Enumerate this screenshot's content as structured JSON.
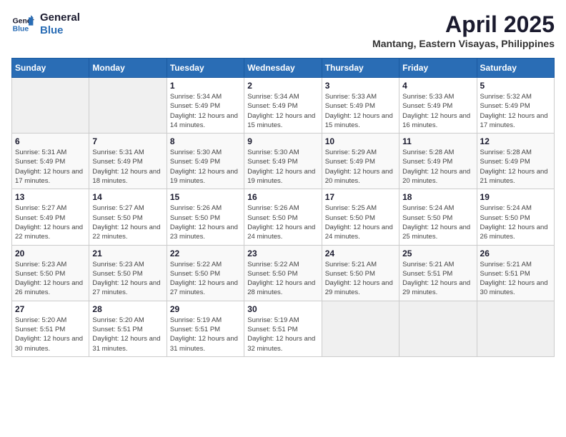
{
  "header": {
    "logo_line1": "General",
    "logo_line2": "Blue",
    "month": "April 2025",
    "location": "Mantang, Eastern Visayas, Philippines"
  },
  "weekdays": [
    "Sunday",
    "Monday",
    "Tuesday",
    "Wednesday",
    "Thursday",
    "Friday",
    "Saturday"
  ],
  "weeks": [
    [
      {
        "day": "",
        "sunrise": "",
        "sunset": "",
        "daylight": ""
      },
      {
        "day": "",
        "sunrise": "",
        "sunset": "",
        "daylight": ""
      },
      {
        "day": "1",
        "sunrise": "Sunrise: 5:34 AM",
        "sunset": "Sunset: 5:49 PM",
        "daylight": "Daylight: 12 hours and 14 minutes."
      },
      {
        "day": "2",
        "sunrise": "Sunrise: 5:34 AM",
        "sunset": "Sunset: 5:49 PM",
        "daylight": "Daylight: 12 hours and 15 minutes."
      },
      {
        "day": "3",
        "sunrise": "Sunrise: 5:33 AM",
        "sunset": "Sunset: 5:49 PM",
        "daylight": "Daylight: 12 hours and 15 minutes."
      },
      {
        "day": "4",
        "sunrise": "Sunrise: 5:33 AM",
        "sunset": "Sunset: 5:49 PM",
        "daylight": "Daylight: 12 hours and 16 minutes."
      },
      {
        "day": "5",
        "sunrise": "Sunrise: 5:32 AM",
        "sunset": "Sunset: 5:49 PM",
        "daylight": "Daylight: 12 hours and 17 minutes."
      }
    ],
    [
      {
        "day": "6",
        "sunrise": "Sunrise: 5:31 AM",
        "sunset": "Sunset: 5:49 PM",
        "daylight": "Daylight: 12 hours and 17 minutes."
      },
      {
        "day": "7",
        "sunrise": "Sunrise: 5:31 AM",
        "sunset": "Sunset: 5:49 PM",
        "daylight": "Daylight: 12 hours and 18 minutes."
      },
      {
        "day": "8",
        "sunrise": "Sunrise: 5:30 AM",
        "sunset": "Sunset: 5:49 PM",
        "daylight": "Daylight: 12 hours and 19 minutes."
      },
      {
        "day": "9",
        "sunrise": "Sunrise: 5:30 AM",
        "sunset": "Sunset: 5:49 PM",
        "daylight": "Daylight: 12 hours and 19 minutes."
      },
      {
        "day": "10",
        "sunrise": "Sunrise: 5:29 AM",
        "sunset": "Sunset: 5:49 PM",
        "daylight": "Daylight: 12 hours and 20 minutes."
      },
      {
        "day": "11",
        "sunrise": "Sunrise: 5:28 AM",
        "sunset": "Sunset: 5:49 PM",
        "daylight": "Daylight: 12 hours and 20 minutes."
      },
      {
        "day": "12",
        "sunrise": "Sunrise: 5:28 AM",
        "sunset": "Sunset: 5:49 PM",
        "daylight": "Daylight: 12 hours and 21 minutes."
      }
    ],
    [
      {
        "day": "13",
        "sunrise": "Sunrise: 5:27 AM",
        "sunset": "Sunset: 5:49 PM",
        "daylight": "Daylight: 12 hours and 22 minutes."
      },
      {
        "day": "14",
        "sunrise": "Sunrise: 5:27 AM",
        "sunset": "Sunset: 5:50 PM",
        "daylight": "Daylight: 12 hours and 22 minutes."
      },
      {
        "day": "15",
        "sunrise": "Sunrise: 5:26 AM",
        "sunset": "Sunset: 5:50 PM",
        "daylight": "Daylight: 12 hours and 23 minutes."
      },
      {
        "day": "16",
        "sunrise": "Sunrise: 5:26 AM",
        "sunset": "Sunset: 5:50 PM",
        "daylight": "Daylight: 12 hours and 24 minutes."
      },
      {
        "day": "17",
        "sunrise": "Sunrise: 5:25 AM",
        "sunset": "Sunset: 5:50 PM",
        "daylight": "Daylight: 12 hours and 24 minutes."
      },
      {
        "day": "18",
        "sunrise": "Sunrise: 5:24 AM",
        "sunset": "Sunset: 5:50 PM",
        "daylight": "Daylight: 12 hours and 25 minutes."
      },
      {
        "day": "19",
        "sunrise": "Sunrise: 5:24 AM",
        "sunset": "Sunset: 5:50 PM",
        "daylight": "Daylight: 12 hours and 26 minutes."
      }
    ],
    [
      {
        "day": "20",
        "sunrise": "Sunrise: 5:23 AM",
        "sunset": "Sunset: 5:50 PM",
        "daylight": "Daylight: 12 hours and 26 minutes."
      },
      {
        "day": "21",
        "sunrise": "Sunrise: 5:23 AM",
        "sunset": "Sunset: 5:50 PM",
        "daylight": "Daylight: 12 hours and 27 minutes."
      },
      {
        "day": "22",
        "sunrise": "Sunrise: 5:22 AM",
        "sunset": "Sunset: 5:50 PM",
        "daylight": "Daylight: 12 hours and 27 minutes."
      },
      {
        "day": "23",
        "sunrise": "Sunrise: 5:22 AM",
        "sunset": "Sunset: 5:50 PM",
        "daylight": "Daylight: 12 hours and 28 minutes."
      },
      {
        "day": "24",
        "sunrise": "Sunrise: 5:21 AM",
        "sunset": "Sunset: 5:50 PM",
        "daylight": "Daylight: 12 hours and 29 minutes."
      },
      {
        "day": "25",
        "sunrise": "Sunrise: 5:21 AM",
        "sunset": "Sunset: 5:51 PM",
        "daylight": "Daylight: 12 hours and 29 minutes."
      },
      {
        "day": "26",
        "sunrise": "Sunrise: 5:21 AM",
        "sunset": "Sunset: 5:51 PM",
        "daylight": "Daylight: 12 hours and 30 minutes."
      }
    ],
    [
      {
        "day": "27",
        "sunrise": "Sunrise: 5:20 AM",
        "sunset": "Sunset: 5:51 PM",
        "daylight": "Daylight: 12 hours and 30 minutes."
      },
      {
        "day": "28",
        "sunrise": "Sunrise: 5:20 AM",
        "sunset": "Sunset: 5:51 PM",
        "daylight": "Daylight: 12 hours and 31 minutes."
      },
      {
        "day": "29",
        "sunrise": "Sunrise: 5:19 AM",
        "sunset": "Sunset: 5:51 PM",
        "daylight": "Daylight: 12 hours and 31 minutes."
      },
      {
        "day": "30",
        "sunrise": "Sunrise: 5:19 AM",
        "sunset": "Sunset: 5:51 PM",
        "daylight": "Daylight: 12 hours and 32 minutes."
      },
      {
        "day": "",
        "sunrise": "",
        "sunset": "",
        "daylight": ""
      },
      {
        "day": "",
        "sunrise": "",
        "sunset": "",
        "daylight": ""
      },
      {
        "day": "",
        "sunrise": "",
        "sunset": "",
        "daylight": ""
      }
    ]
  ]
}
